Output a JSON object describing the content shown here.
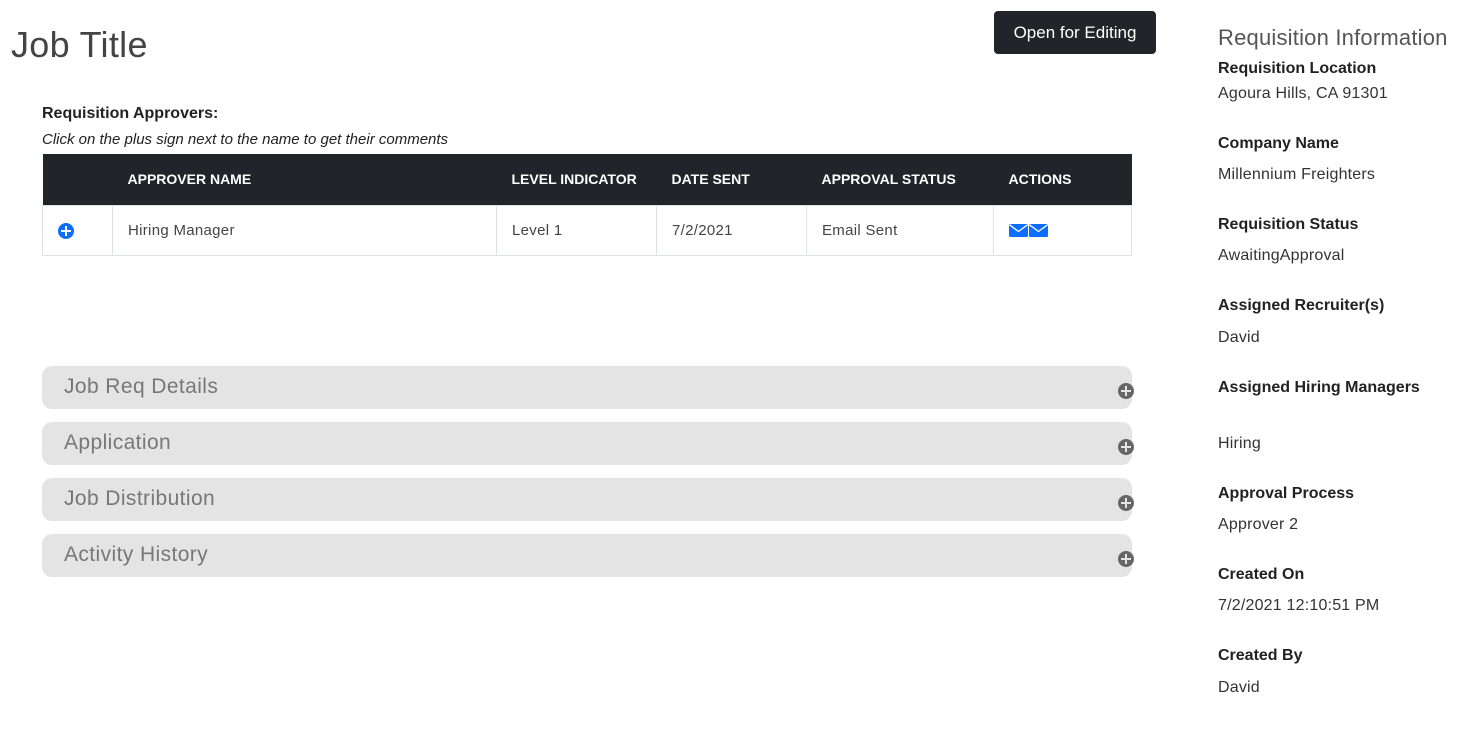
{
  "page": {
    "title": "Job Title",
    "open_for_editing_label": "Open for Editing"
  },
  "approvers": {
    "heading": "Requisition Approvers:",
    "hint": "Click on the plus sign next to the name to get their comments",
    "columns": [
      "",
      "APPROVER NAME",
      "LEVEL INDICATOR",
      "DATE SENT",
      "APPROVAL STATUS",
      "ACTIONS"
    ],
    "rows": [
      {
        "name": "Hiring Manager",
        "level": "Level 1",
        "date_sent": "7/2/2021",
        "status": "Email Sent",
        "action_icons": [
          "envelope-icon",
          "envelope-icon"
        ]
      }
    ]
  },
  "sections": [
    {
      "label": "Job Req Details",
      "icon": "plus-circle-icon"
    },
    {
      "label": "Application",
      "icon": "plus-circle-icon"
    },
    {
      "label": "Job Distribution",
      "icon": "plus-circle-icon"
    },
    {
      "label": "Activity History",
      "icon": "plus-circle-icon"
    }
  ],
  "sidebar": {
    "title": "Requisition Information",
    "items": [
      {
        "label": "Requisition Location",
        "value": "Agoura Hills, CA 91301"
      },
      {
        "label": "Company Name",
        "value": "Millennium Freighters"
      },
      {
        "label": "Requisition Status",
        "value": "AwaitingApproval"
      },
      {
        "label": "Assigned Recruiter(s)",
        "value": "David"
      },
      {
        "label": "Assigned Hiring Managers",
        "value": "Hiring"
      },
      {
        "label": "Approval Process",
        "value": "Approver 2"
      },
      {
        "label": "Created On",
        "value": "7/2/2021 12:10:51 PM"
      },
      {
        "label": "Created By",
        "value": "David"
      }
    ]
  },
  "colors": {
    "header_dark": "#212529",
    "accent_blue": "#0d6efd",
    "accordion_bg": "#e4e4e4",
    "accordion_text": "#777777"
  }
}
